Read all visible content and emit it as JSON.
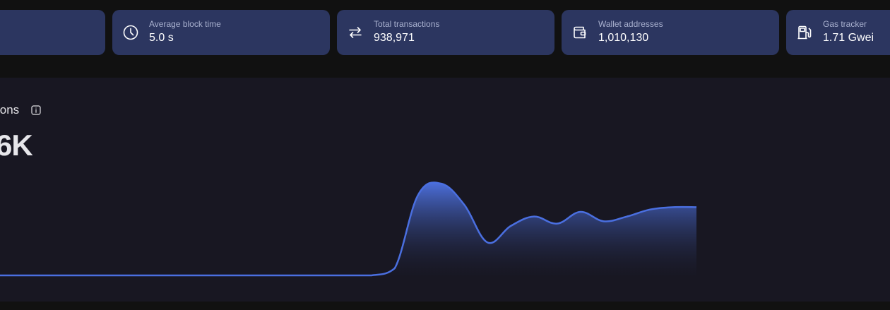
{
  "stats": [
    {
      "label": "",
      "value": "",
      "icon": ""
    },
    {
      "label": "Average block time",
      "value": "5.0 s",
      "icon": "clock-icon"
    },
    {
      "label": "Total transactions",
      "value": "938,971",
      "icon": "arrows-swap-icon"
    },
    {
      "label": "Wallet addresses",
      "value": "1,010,130",
      "icon": "wallet-icon"
    },
    {
      "label": "Gas tracker",
      "value": "1.71 Gwei",
      "icon": "gas-pump-icon"
    }
  ],
  "chart": {
    "title": "ions",
    "value": "6K"
  },
  "colors": {
    "card_bg": "#2c3660",
    "panel_bg": "#181722",
    "line": "#4a6fe0",
    "fill_top": "#4f74e6",
    "fill_bottom": "#1a1b2b"
  },
  "chart_data": {
    "type": "area",
    "x": [
      0,
      1,
      2,
      3,
      4,
      5,
      6,
      7,
      8,
      9,
      10,
      11,
      12,
      13,
      14,
      15,
      16,
      17,
      18,
      19,
      20,
      21,
      22,
      23,
      24,
      25,
      26,
      27,
      28,
      29,
      30
    ],
    "values": [
      0,
      0,
      0,
      0,
      0,
      0,
      0,
      0,
      0,
      0,
      0,
      0,
      0,
      0,
      0,
      0,
      0,
      0.3,
      3.4,
      3.9,
      3.0,
      1.4,
      2.1,
      2.5,
      2.2,
      2.7,
      2.3,
      2.5,
      2.8,
      2.9,
      2.9
    ],
    "title": "",
    "xlabel": "",
    "ylabel": "",
    "grid": false
  }
}
